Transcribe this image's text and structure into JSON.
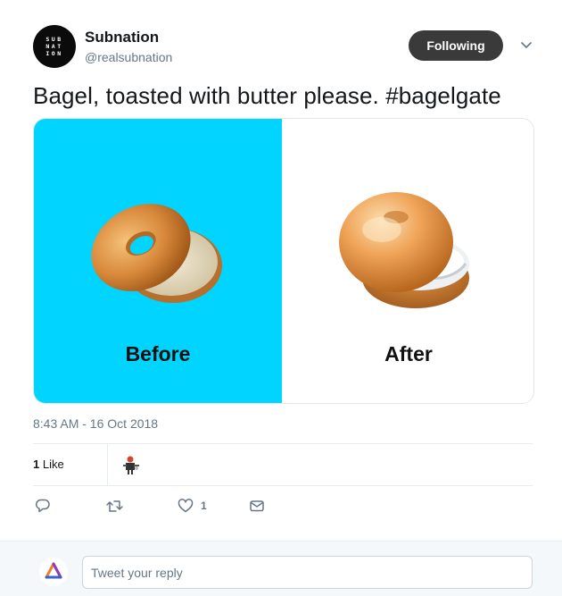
{
  "author": {
    "display_name": "Subnation",
    "handle": "@realsubnation",
    "avatar_text": [
      "SUB",
      "NAT",
      "ION"
    ]
  },
  "follow_button": {
    "label": "Following"
  },
  "tweet": {
    "text": "Bagel, toasted with butter please. #bagelgate",
    "timestamp": "8:43 AM - 16 Oct 2018"
  },
  "media": {
    "before_label": "Before",
    "after_label": "After",
    "before_bg": "#00d4ff",
    "after_bg": "#ffffff"
  },
  "stats": {
    "likes_count": "1",
    "likes_label": "Like"
  },
  "actions": {
    "reply_icon": "reply-icon",
    "retweet_icon": "retweet-icon",
    "like_icon": "heart-icon",
    "like_count": "1",
    "dm_icon": "envelope-icon"
  },
  "reply": {
    "placeholder": "Tweet your reply"
  },
  "colors": {
    "follow_bg": "#3a3a3a",
    "secondary_text": "#657786",
    "divider": "#e6ecf0"
  }
}
